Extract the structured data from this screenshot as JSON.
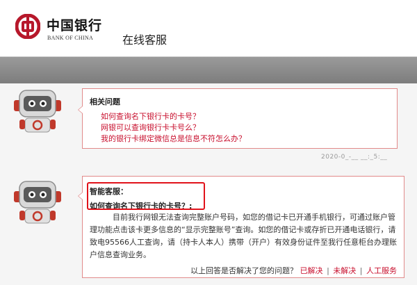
{
  "header": {
    "logo_cn": "中国银行",
    "logo_en": "BANK OF CHINA",
    "title": "在线客服"
  },
  "related": {
    "title": "相关问题",
    "questions": [
      "如何查询名下银行卡的卡号？",
      "网银可以查询银行卡卡号么？",
      "我的银行卡绑定微信总是信息不符怎么办？"
    ]
  },
  "timestamp": "2020-0_-__ __:_5:__",
  "answer": {
    "speaker": "智能客服：",
    "question": "如何查询名下银行卡的卡号？:",
    "body": "目前我行网银无法查询完整账户号码，如您的借记卡已开通手机银行，可通过账户管理功能点击该卡更多信息的“显示完整账号”查询。如您的借记卡或存折已开通电话银行，请致电95566人工查询，请（持卡人本人）携带（开户）有效身份证件至我行任意柜台办理账户信息查询业务。",
    "feedback_prompt": "以上回答是否解决了您的问题？",
    "resolved": "已解决",
    "unresolved": "未解决",
    "human": "人工服务",
    "separator": "|"
  },
  "colors": {
    "brand_red": "#c8102e",
    "border_red": "#e18a8a",
    "highlight": "#e1121a",
    "band_grey": "#8a8a8a"
  },
  "icons": {
    "logo": "boc-logo-icon",
    "robot": "robot-avatar-icon"
  }
}
